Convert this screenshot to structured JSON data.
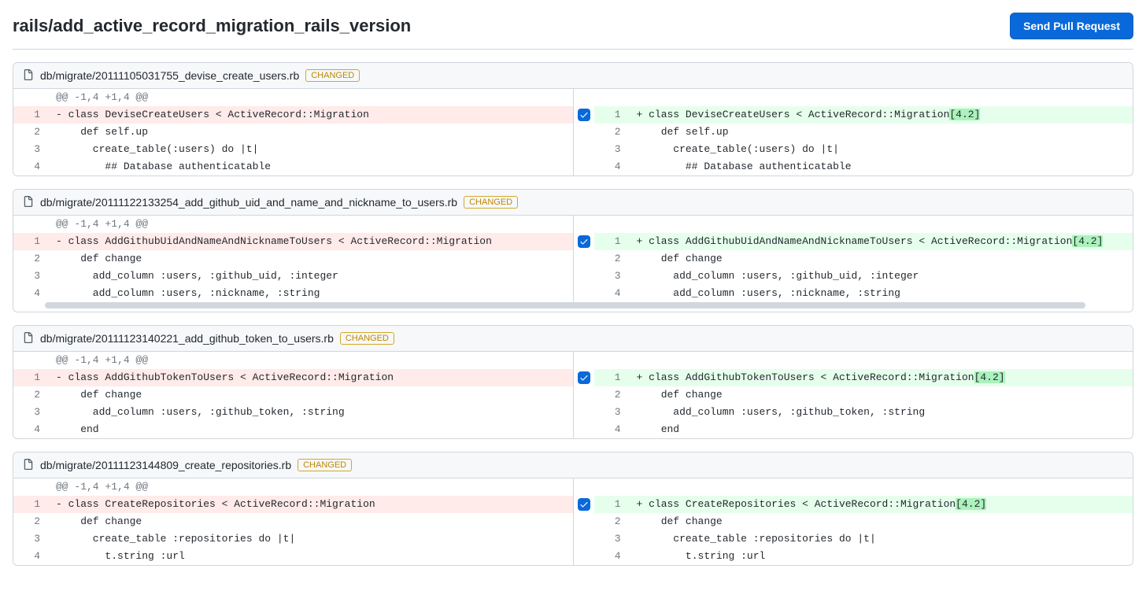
{
  "title": "rails/add_active_record_migration_rails_version",
  "send_button": "Send Pull Request",
  "badge_label": "CHANGED",
  "hunk_header": "@@ -1,4 +1,4 @@",
  "version_tag": "[4.2]",
  "files": [
    {
      "path": "db/migrate/20111105031755_devise_create_users.rb",
      "left": [
        {
          "n": "1",
          "type": "del",
          "code": "class DeviseCreateUsers < ActiveRecord::Migration"
        },
        {
          "n": "2",
          "type": "ctx",
          "code": "  def self.up"
        },
        {
          "n": "3",
          "type": "ctx",
          "code": "    create_table(:users) do |t|"
        },
        {
          "n": "4",
          "type": "ctx",
          "code": "      ## Database authenticatable"
        }
      ],
      "right": [
        {
          "n": "1",
          "type": "add",
          "code": "class DeviseCreateUsers < ActiveRecord::Migration",
          "hl": true
        },
        {
          "n": "2",
          "type": "ctx",
          "code": "  def self.up"
        },
        {
          "n": "3",
          "type": "ctx",
          "code": "    create_table(:users) do |t|"
        },
        {
          "n": "4",
          "type": "ctx",
          "code": "      ## Database authenticatable"
        }
      ]
    },
    {
      "path": "db/migrate/20111122133254_add_github_uid_and_name_and_nickname_to_users.rb",
      "scrollbar": true,
      "left": [
        {
          "n": "1",
          "type": "del",
          "code": "class AddGithubUidAndNameAndNicknameToUsers < ActiveRecord::Migration"
        },
        {
          "n": "2",
          "type": "ctx",
          "code": "  def change"
        },
        {
          "n": "3",
          "type": "ctx",
          "code": "    add_column :users, :github_uid, :integer"
        },
        {
          "n": "4",
          "type": "ctx",
          "code": "    add_column :users, :nickname, :string"
        }
      ],
      "right": [
        {
          "n": "1",
          "type": "add",
          "code": "class AddGithubUidAndNameAndNicknameToUsers < ActiveRecord::Migration",
          "hl": true
        },
        {
          "n": "2",
          "type": "ctx",
          "code": "  def change"
        },
        {
          "n": "3",
          "type": "ctx",
          "code": "    add_column :users, :github_uid, :integer"
        },
        {
          "n": "4",
          "type": "ctx",
          "code": "    add_column :users, :nickname, :string"
        }
      ]
    },
    {
      "path": "db/migrate/20111123140221_add_github_token_to_users.rb",
      "left": [
        {
          "n": "1",
          "type": "del",
          "code": "class AddGithubTokenToUsers < ActiveRecord::Migration"
        },
        {
          "n": "2",
          "type": "ctx",
          "code": "  def change"
        },
        {
          "n": "3",
          "type": "ctx",
          "code": "    add_column :users, :github_token, :string"
        },
        {
          "n": "4",
          "type": "ctx",
          "code": "  end"
        }
      ],
      "right": [
        {
          "n": "1",
          "type": "add",
          "code": "class AddGithubTokenToUsers < ActiveRecord::Migration",
          "hl": true
        },
        {
          "n": "2",
          "type": "ctx",
          "code": "  def change"
        },
        {
          "n": "3",
          "type": "ctx",
          "code": "    add_column :users, :github_token, :string"
        },
        {
          "n": "4",
          "type": "ctx",
          "code": "  end"
        }
      ]
    },
    {
      "path": "db/migrate/20111123144809_create_repositories.rb",
      "left": [
        {
          "n": "1",
          "type": "del",
          "code": "class CreateRepositories < ActiveRecord::Migration"
        },
        {
          "n": "2",
          "type": "ctx",
          "code": "  def change"
        },
        {
          "n": "3",
          "type": "ctx",
          "code": "    create_table :repositories do |t|"
        },
        {
          "n": "4",
          "type": "ctx",
          "code": "      t.string :url"
        }
      ],
      "right": [
        {
          "n": "1",
          "type": "add",
          "code": "class CreateRepositories < ActiveRecord::Migration",
          "hl": true
        },
        {
          "n": "2",
          "type": "ctx",
          "code": "  def change"
        },
        {
          "n": "3",
          "type": "ctx",
          "code": "    create_table :repositories do |t|"
        },
        {
          "n": "4",
          "type": "ctx",
          "code": "      t.string :url"
        }
      ]
    }
  ]
}
